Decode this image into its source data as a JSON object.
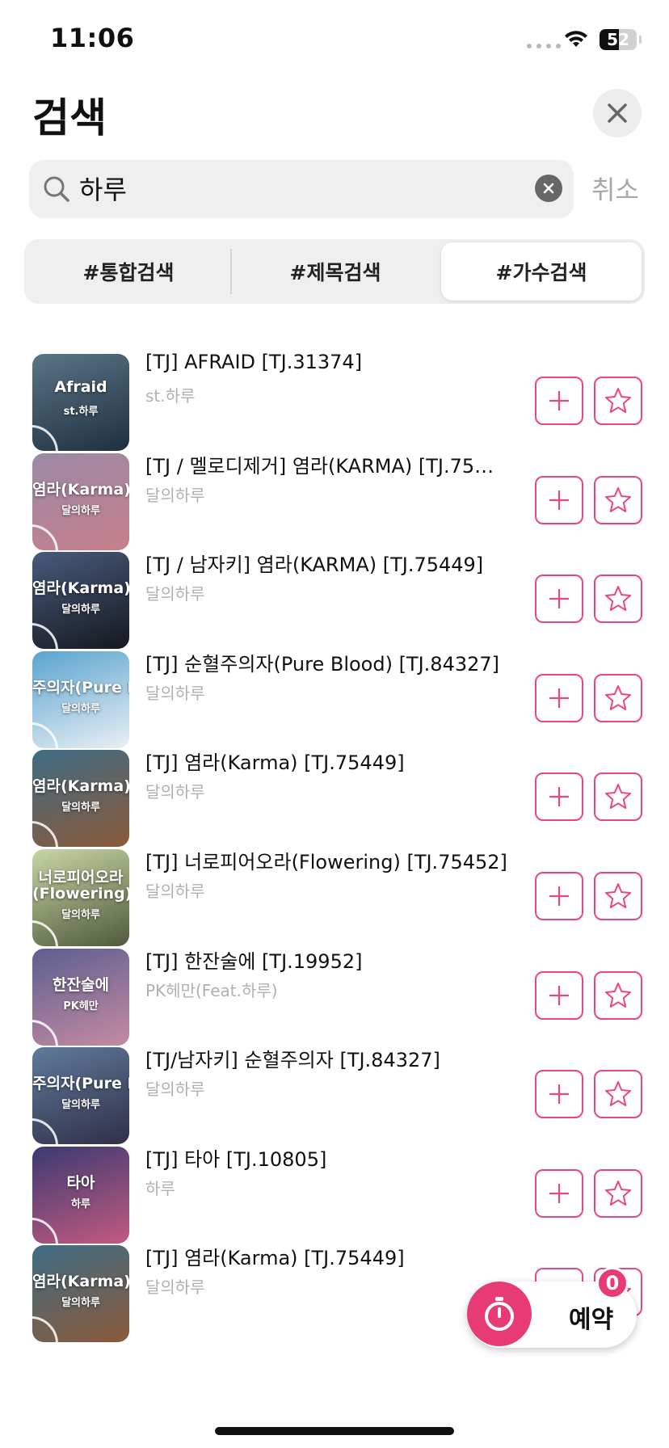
{
  "status_bar": {
    "time": "11:06",
    "battery_level": "52",
    "battery_percent": 0.52
  },
  "header": {
    "title": "검색"
  },
  "search": {
    "value": "하루",
    "cancel_label": "취소"
  },
  "tabs": [
    {
      "label": "#통합검색",
      "selected": false
    },
    {
      "label": "#제목검색",
      "selected": false
    },
    {
      "label": "#가수검색",
      "selected": true
    }
  ],
  "songs": [
    {
      "title": "[TJ] AFRAID [TJ.31374]",
      "artist": "st.하루",
      "art_title": "Afraid",
      "art_artist": "st.하루",
      "art_colors": [
        "#5a7586",
        "#1f3040"
      ]
    },
    {
      "title": "[TJ / 멜로디제거] 염라(KARMA) [TJ.75…",
      "artist": "달의하루",
      "art_title": "염라(Karma)",
      "art_artist": "달의하루",
      "art_colors": [
        "#9b8aa6",
        "#c77f8c"
      ]
    },
    {
      "title": "[TJ / 남자키] 염라(KARMA) [TJ.75449]",
      "artist": "달의하루",
      "art_title": "염라(Karma)",
      "art_artist": "달의하루",
      "art_colors": [
        "#485b7c",
        "#16181f"
      ]
    },
    {
      "title": "[TJ] 순혈주의자(Pure Blood) [TJ.84327]",
      "artist": "달의하루",
      "art_title": "주의자(Pure Bl",
      "art_artist": "달의하루",
      "art_colors": [
        "#5aa4cf",
        "#e9eff4"
      ]
    },
    {
      "title": "[TJ] 염라(Karma) [TJ.75449]",
      "artist": "달의하루",
      "art_title": "염라(Karma)",
      "art_artist": "달의하루",
      "art_colors": [
        "#3f6c84",
        "#8a5a3a"
      ]
    },
    {
      "title": "[TJ] 너로피어오라(Flowering) [TJ.75452]",
      "artist": "달의하루",
      "art_title": "너로피어오라",
      "art_subtitle": "(Flowering)",
      "art_artist": "달의하루",
      "art_colors": [
        "#c9d6a6",
        "#4f5a3a"
      ]
    },
    {
      "title": "[TJ] 한잔술에 [TJ.19952]",
      "artist": "PK헤만(Feat.하루)",
      "art_title": "한잔술에",
      "art_artist": "PK헤만",
      "art_colors": [
        "#5c5f90",
        "#c58aa2"
      ]
    },
    {
      "title": "[TJ/남자키] 순혈주의자 [TJ.84327]",
      "artist": "달의하루",
      "art_title": "주의자(Pure Bl",
      "art_artist": "달의하루",
      "art_colors": [
        "#5f7b9a",
        "#312f48"
      ]
    },
    {
      "title": "[TJ] 타아 [TJ.10805]",
      "artist": "하루",
      "art_title": "타아",
      "art_artist": "하루",
      "art_colors": [
        "#3b3a72",
        "#c25a7f"
      ]
    },
    {
      "title": "[TJ] 염라(Karma) [TJ.75449]",
      "artist": "달의하루",
      "art_title": "염라(Karma)",
      "art_artist": "달의하루",
      "art_colors": [
        "#3f6c84",
        "#8a5a3a"
      ]
    }
  ],
  "reserve": {
    "label": "예약",
    "count": "0"
  },
  "colors": {
    "accent": "#e8487a",
    "reserve_accent": "#e83a74",
    "secondary_text": "#b0b0b0"
  },
  "icons": {
    "close": "close-icon",
    "search": "search-icon",
    "clear": "clear-icon",
    "add": "plus-icon",
    "favorite": "star-icon",
    "reserve": "stopwatch-icon"
  }
}
